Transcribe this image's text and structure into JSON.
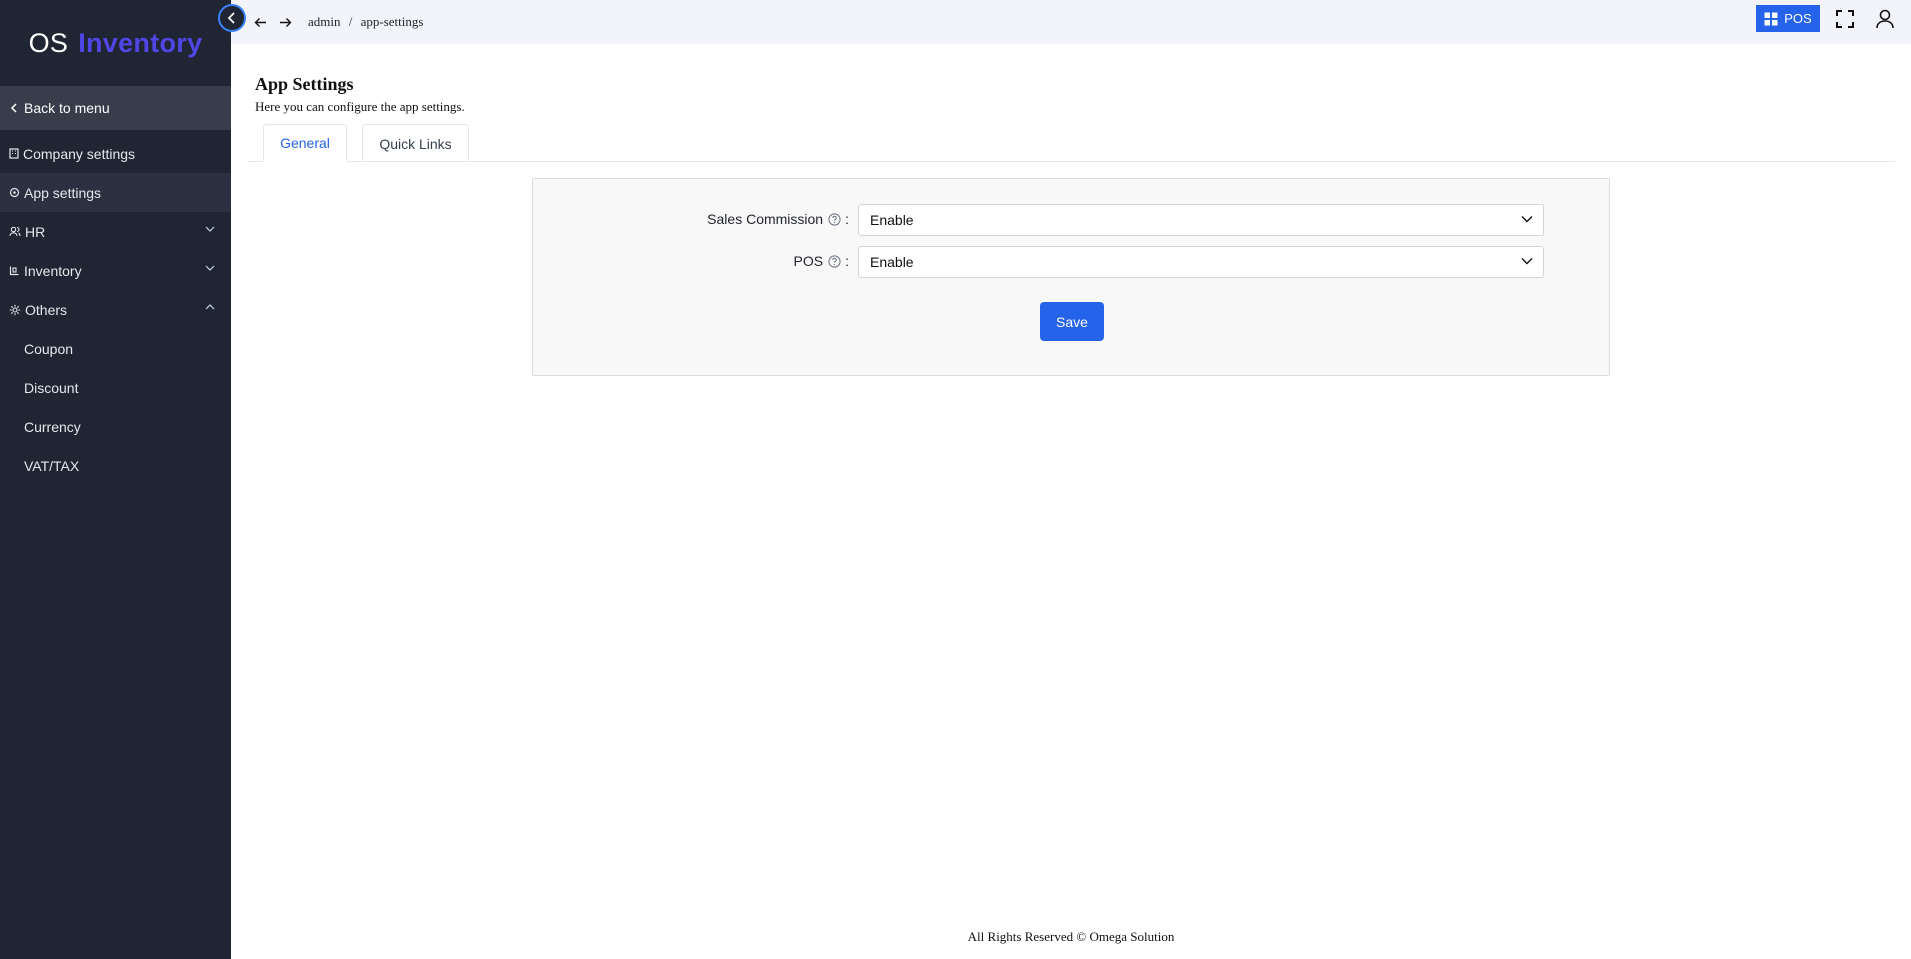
{
  "sidebar": {
    "logo_part1": "OS",
    "logo_part2": "Inventory",
    "back_label": "Back to menu",
    "items": [
      {
        "label": "Company settings"
      },
      {
        "label": "App settings"
      },
      {
        "label": "HR"
      },
      {
        "label": "Inventory"
      },
      {
        "label": "Others"
      }
    ],
    "sub_items": [
      {
        "label": "Coupon"
      },
      {
        "label": "Discount"
      },
      {
        "label": "Currency"
      },
      {
        "label": "VAT/TAX"
      }
    ]
  },
  "topbar": {
    "breadcrumb_root": "admin",
    "breadcrumb_sep": "/",
    "breadcrumb_page": "app-settings",
    "pos_label": "POS"
  },
  "page": {
    "title": "App Settings",
    "subtitle": "Here you can configure the app settings."
  },
  "tabs": [
    {
      "label": "General"
    },
    {
      "label": "Quick Links"
    }
  ],
  "form": {
    "fields": [
      {
        "label": "Sales Commission",
        "colon": ":",
        "value": "Enable"
      },
      {
        "label": "POS",
        "colon": ":",
        "value": "Enable"
      }
    ],
    "save_label": "Save"
  },
  "footer": {
    "text": "All Rights Reserved © Omega Solution"
  },
  "colors": {
    "sidebar_bg": "#1f2533",
    "accent": "#2563eb",
    "logo_accent": "#4f46e5"
  }
}
